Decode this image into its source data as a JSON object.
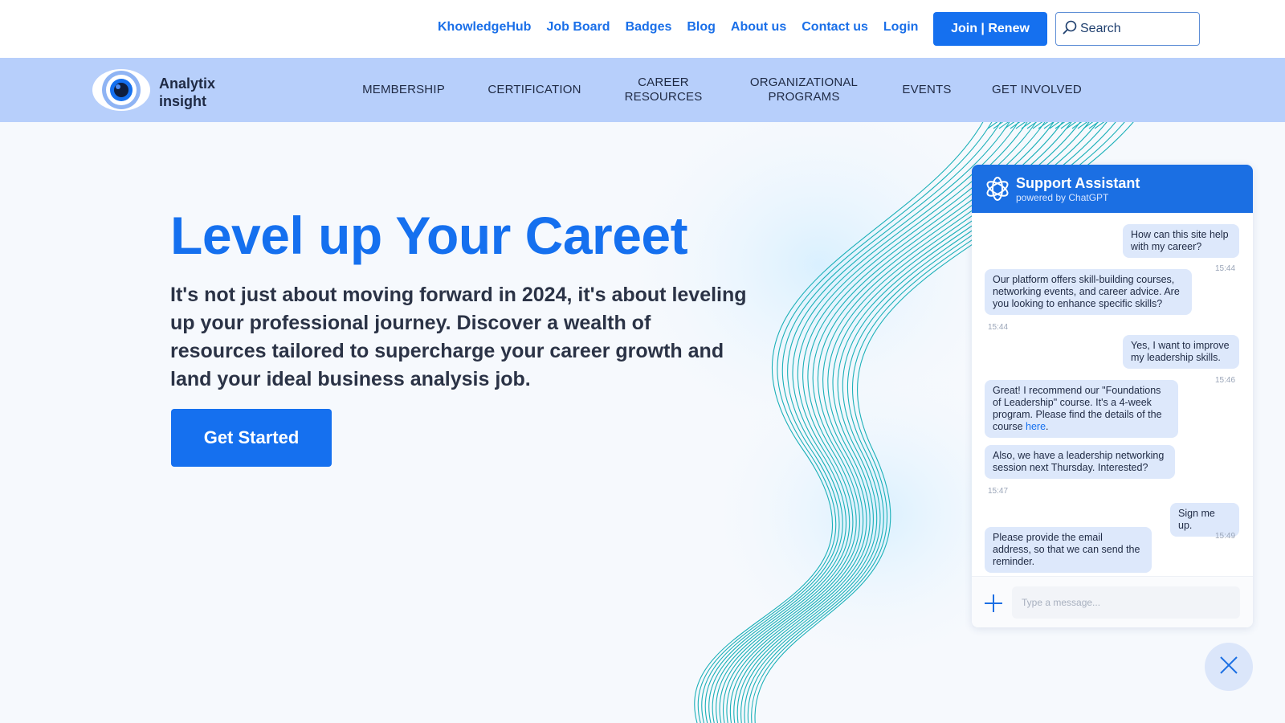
{
  "topbar": {
    "links": [
      "KhowledgeHub",
      "Job Board",
      "Badges",
      "Blog",
      "About us",
      "Contact us",
      "Login"
    ],
    "join_label": "Join | Renew",
    "search_placeholder": "Search"
  },
  "brand": {
    "name_line1": "Analytix",
    "name_line2": "insight"
  },
  "nav": {
    "items": [
      {
        "line1": "MEMBERSHIP",
        "line2": ""
      },
      {
        "line1": "CERTIFICATION",
        "line2": ""
      },
      {
        "line1": "CAREER",
        "line2": "RESOURCES"
      },
      {
        "line1": "ORGANIZATIONAL",
        "line2": "PROGRAMS"
      },
      {
        "line1": "EVENTS",
        "line2": ""
      },
      {
        "line1": "GET INVOLVED",
        "line2": ""
      }
    ]
  },
  "hero": {
    "title": "Level up Your Careet",
    "subtitle": "It's not just about moving forward in 2024, it's about leveling up your professional journey. Discover a wealth of resources tailored to supercharge your career growth and land your ideal business analysis job.",
    "cta_label": "Get Started"
  },
  "chat": {
    "title": "Support Assistant",
    "subtitle": "powered by ChatGPT",
    "messages": [
      {
        "from": "user",
        "text": "How can this site help with my career?",
        "time": "15:44"
      },
      {
        "from": "bot",
        "text": "Our platform offers skill-building courses, networking events, and career advice. Are you looking to enhance specific skills?",
        "time": "15:44"
      },
      {
        "from": "user",
        "text": "Yes, I want to improve my leadership skills.",
        "time": "15:46"
      },
      {
        "from": "bot",
        "text_before_link": "Great! I recommend our \"Foundations of Leadership\" course. It's a 4-week program. Please find the details of the course ",
        "link": "here",
        "text_after_link": ".",
        "time": ""
      },
      {
        "from": "bot",
        "text": "Also, we have a leadership networking session next Thursday. Interested?",
        "time": "15:47"
      },
      {
        "from": "user",
        "text": "Sign me up.",
        "time": "15:49"
      },
      {
        "from": "bot",
        "text": "Please provide the email address, so that we can send the reminder.",
        "time": ""
      }
    ],
    "input_placeholder": "Type a message..."
  },
  "colors": {
    "accent": "#1570ef",
    "nav_bg": "#b7cffb",
    "chat_header": "#1b6fe3",
    "bubble": "#dde8fb",
    "wave": "#1cb0b8"
  },
  "icons": [
    "search-icon",
    "eye-logo-icon",
    "chatgpt-icon",
    "plus-icon",
    "close-icon"
  ]
}
